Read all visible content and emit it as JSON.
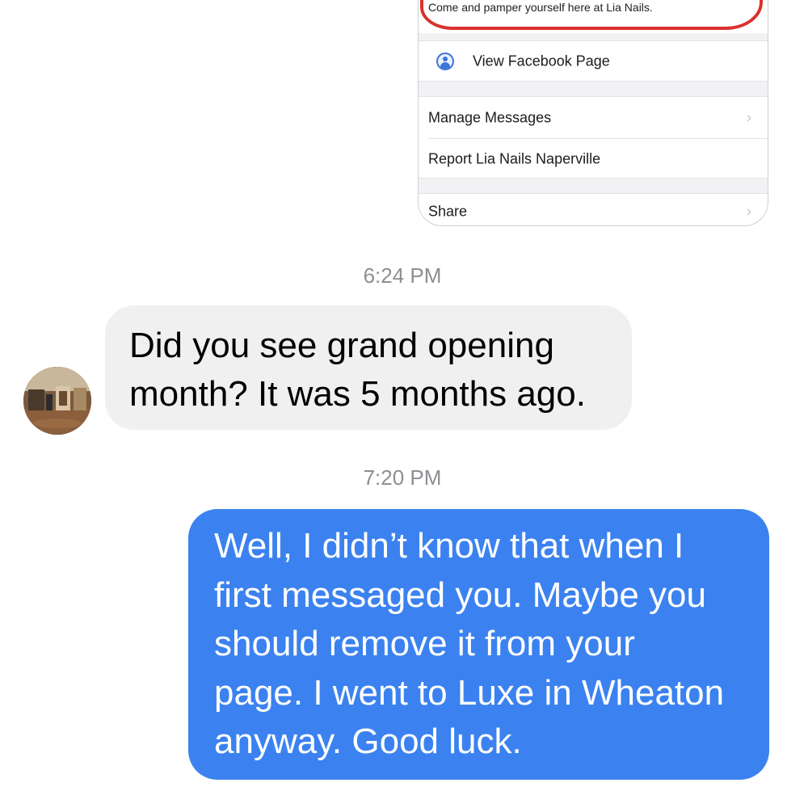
{
  "shared_screenshot": {
    "description": "Come and pamper yourself here at Lia Nails.",
    "view_page_label": "View Facebook Page",
    "manage_messages_label": "Manage Messages",
    "report_label": "Report Lia Nails Naperville",
    "share_label": "Share",
    "chevron": "›",
    "icons": {
      "facebook_page": "person-circle-icon"
    },
    "colors": {
      "highlight_circle": "#d9322f",
      "icon_blue": "#3b74d7"
    }
  },
  "conversation": {
    "timestamp_1": "6:24 PM",
    "incoming_message": {
      "lines": [
        "Did you see grand opening",
        "month? It was 5 months ago."
      ]
    },
    "timestamp_2": "7:20 PM",
    "outgoing_message": {
      "lines": [
        "Well, I didn’t know that when I",
        "first messaged you. Maybe you",
        "should remove it from your",
        "page. I went to Luxe in Wheaton",
        "anyway. Good luck."
      ]
    },
    "colors": {
      "incoming_bubble": "#f0f0f0",
      "outgoing_bubble": "#3b82f0",
      "timestamp_text": "#8e8e93"
    }
  }
}
